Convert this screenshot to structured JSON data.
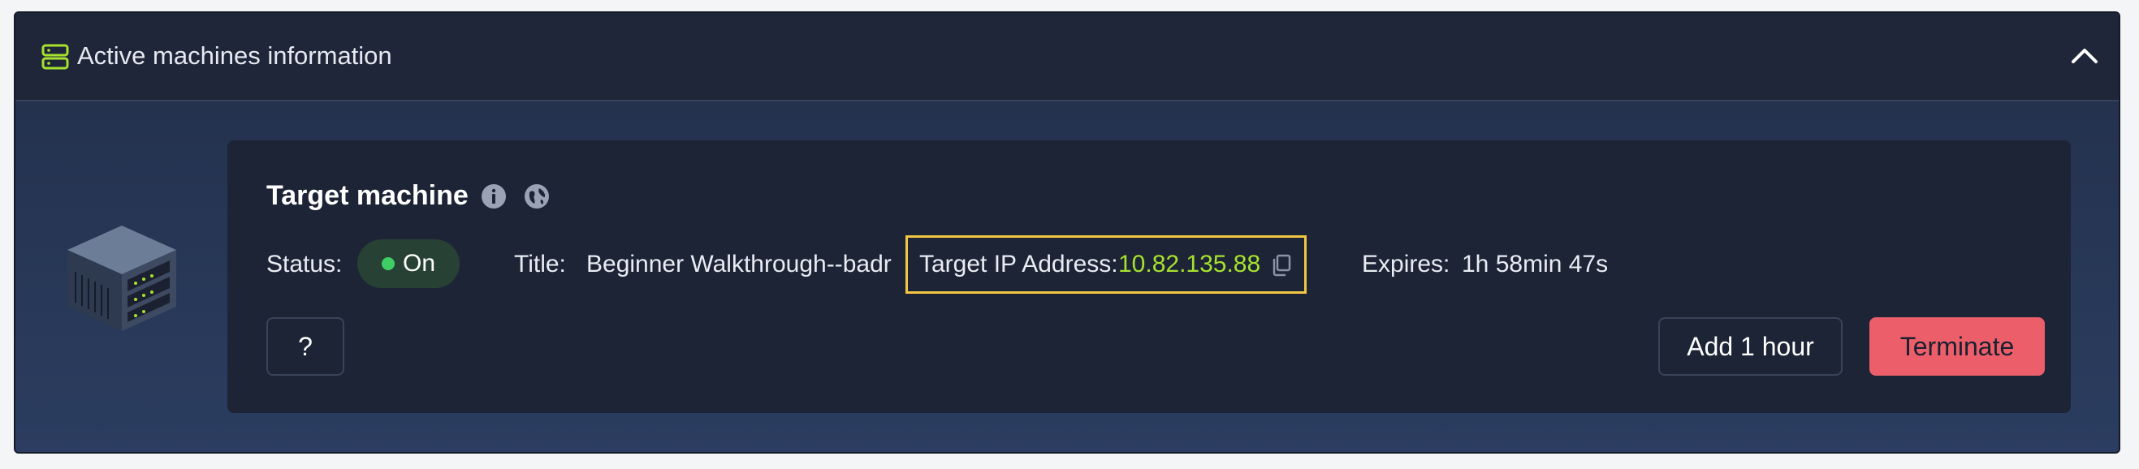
{
  "header": {
    "title": "Active machines information",
    "icon": "server-icon",
    "collapse_icon": "chevron-up-icon"
  },
  "machine": {
    "image": "server-box-image",
    "card_title": "Target machine",
    "icons": [
      "info-icon",
      "globe-icon"
    ],
    "status_label": "Status:",
    "status_value": "On",
    "title_label": "Title:",
    "title_value": "Beginner Walkthrough--badr",
    "ip_label": "Target IP Address:",
    "ip_value": "10.82.135.88",
    "expires_label": "Expires:",
    "expires_value": "1h 58min 47s"
  },
  "buttons": {
    "help": "?",
    "add_hour": "Add 1 hour",
    "terminate": "Terminate"
  },
  "colors": {
    "accent_green": "#a6e22e",
    "status_green": "#3fce66",
    "highlight_yellow": "#f2c744",
    "terminate_red": "#ec5f6a",
    "header_bg": "#1f2639",
    "card_bg": "#1d2436"
  }
}
